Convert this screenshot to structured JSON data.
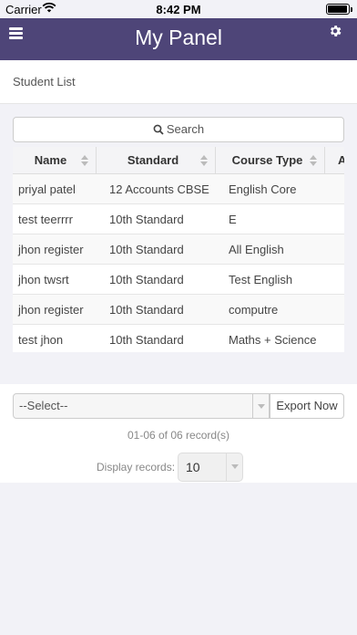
{
  "status_bar": {
    "carrier": "Carrier",
    "time": "8:42 PM"
  },
  "header": {
    "title": "My Panel",
    "menu_icon": "hamburger-icon",
    "settings_icon": "gear-icon",
    "color": "#4e4578"
  },
  "breadcrumb": {
    "label": "Student List"
  },
  "search": {
    "placeholder": "Search",
    "icon": "search-icon"
  },
  "table": {
    "columns": [
      "Name",
      "Standard",
      "Course Type",
      "A"
    ],
    "rows": [
      [
        "priyal patel",
        "12 Accounts CBSE",
        "English Core"
      ],
      [
        "test teerrrr",
        "10th Standard",
        "E"
      ],
      [
        "jhon register",
        "10th Standard",
        "All English"
      ],
      [
        "jhon twsrt",
        "10th Standard",
        "Test English"
      ],
      [
        "jhon register",
        "10th Standard",
        "computre"
      ],
      [
        "test jhon",
        "10th Standard",
        "Maths + Science"
      ]
    ]
  },
  "footer": {
    "select_value": "--Select--",
    "export_label": "Export Now",
    "records_text": "01-06 of 06 record(s)",
    "display_label": "Display records:",
    "display_value": "10"
  }
}
